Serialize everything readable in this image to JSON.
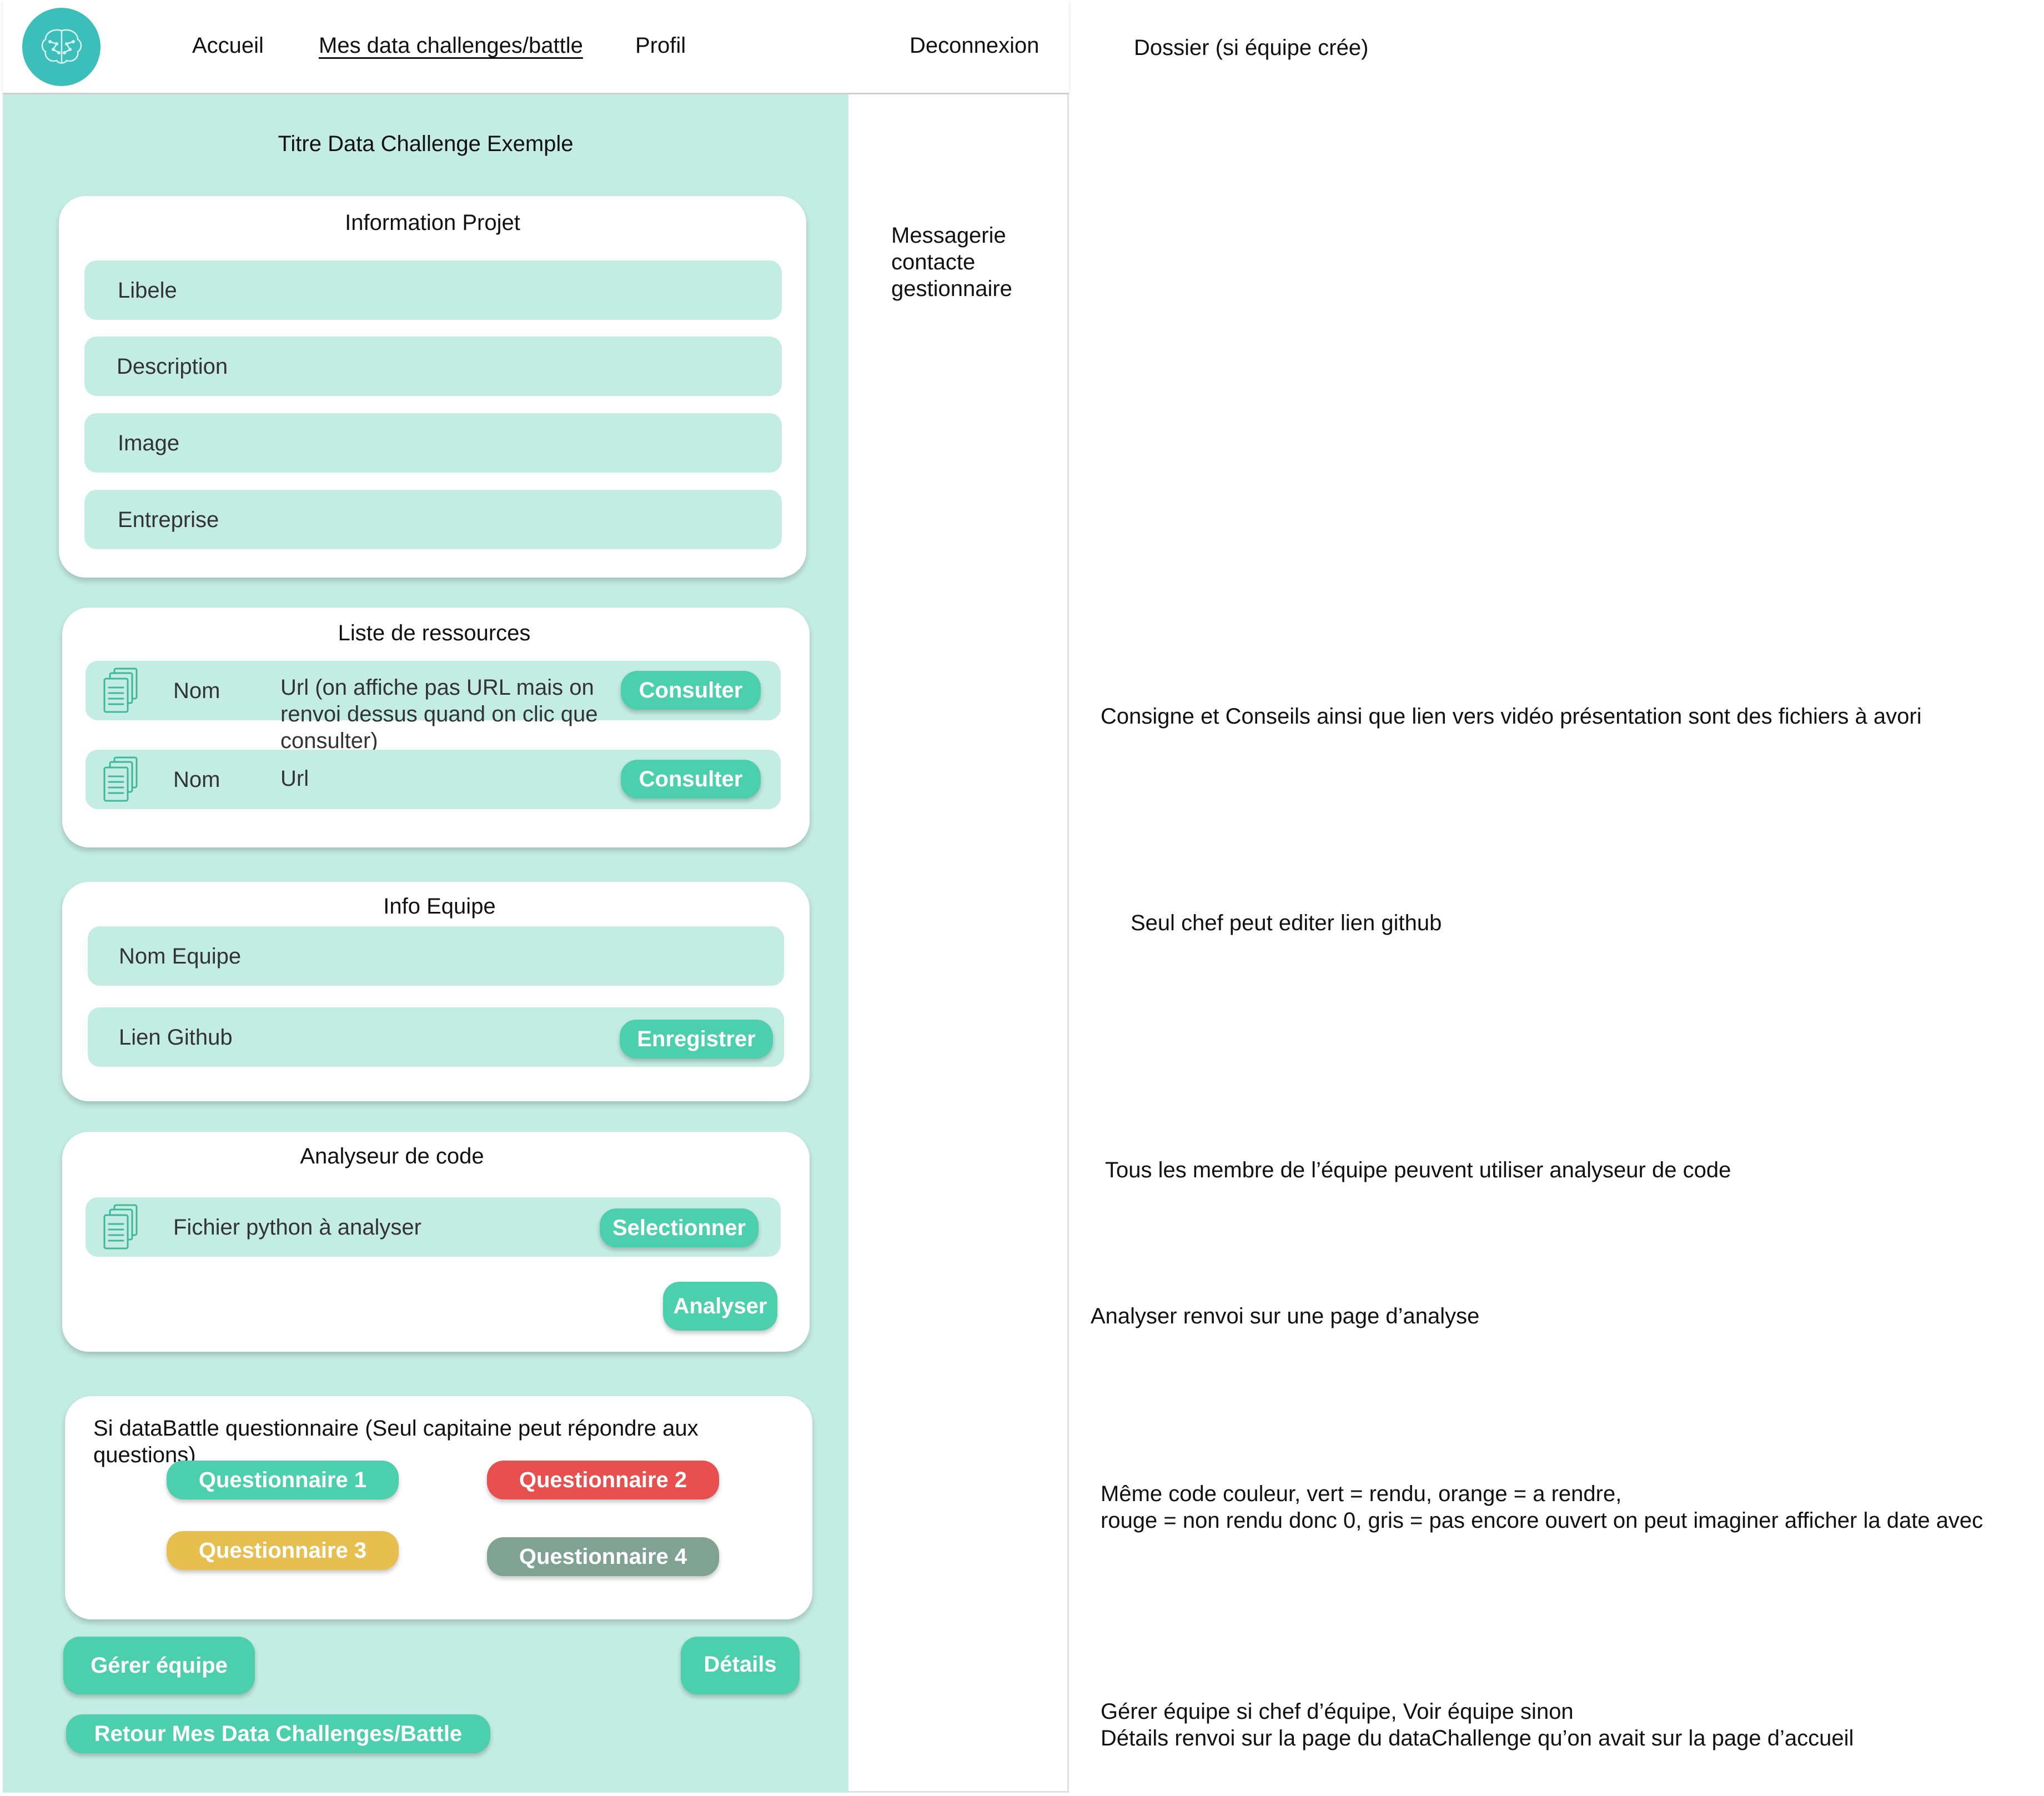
{
  "nav": {
    "logo_icon": "brain-icon",
    "links": [
      "Accueil",
      "Mes data challenges/battle",
      "Profil"
    ],
    "logout": "Deconnexion"
  },
  "page": {
    "title": "Titre Data Challenge Exemple"
  },
  "sidebar": {
    "messaging": "Messagerie\ncontacte\ngestionnaire"
  },
  "project_info": {
    "title": "Information Projet",
    "fields": [
      "Libele",
      "Description",
      "Image",
      "Entreprise"
    ]
  },
  "resources": {
    "title": "Liste de ressources",
    "icon": "document-stack-icon",
    "items": [
      {
        "name": "Nom",
        "url": "Url (on affiche pas URL mais on\nrenvoi dessus quand on clic que\nconsulter)",
        "button": "Consulter"
      },
      {
        "name": "Nom",
        "url": "Url",
        "button": "Consulter"
      }
    ]
  },
  "team": {
    "title": "Info Equipe",
    "name_field": "Nom Equipe",
    "github_field": "Lien Github",
    "save_button": "Enregistrer"
  },
  "analyzer": {
    "title": "Analyseur de code",
    "file_label": "Fichier python à analyser",
    "select_button": "Selectionner",
    "analyze_button": "Analyser"
  },
  "quiz": {
    "title": "Si dataBattle questionnaire (Seul capitaine peut répondre aux\nquestions)",
    "items": [
      {
        "label": "Questionnaire 1",
        "color": "#4ccfac"
      },
      {
        "label": "Questionnaire 2",
        "color": "#e85050"
      },
      {
        "label": "Questionnaire 3",
        "color": "#e6bf4f"
      },
      {
        "label": "Questionnaire 4",
        "color": "#7fa294"
      }
    ]
  },
  "actions": {
    "manage_team": "Gérer équipe",
    "details": "Détails",
    "back": "Retour Mes Data Challenges/Battle"
  },
  "annotations": {
    "folder": "Dossier (si équipe crée)",
    "resources": "Consigne et Conseils ainsi que lien vers vidéo présentation sont des fichiers à avori",
    "github": "Seul chef peut editer lien github",
    "analyzer": "Tous les membre de l’équipe peuvent utiliser analyseur de code",
    "analyze": "Analyser renvoi sur une page d’analyse",
    "colors": "Même code couleur, vert = rendu, orange = a rendre,\nrouge = non rendu donc 0, gris = pas encore ouvert on peut imaginer afficher la date avec",
    "actions": "Gérer équipe si chef d’équipe, Voir équipe sinon\nDétails renvoi sur la page du dataChallenge qu’on avait sur la page d’accueil"
  }
}
